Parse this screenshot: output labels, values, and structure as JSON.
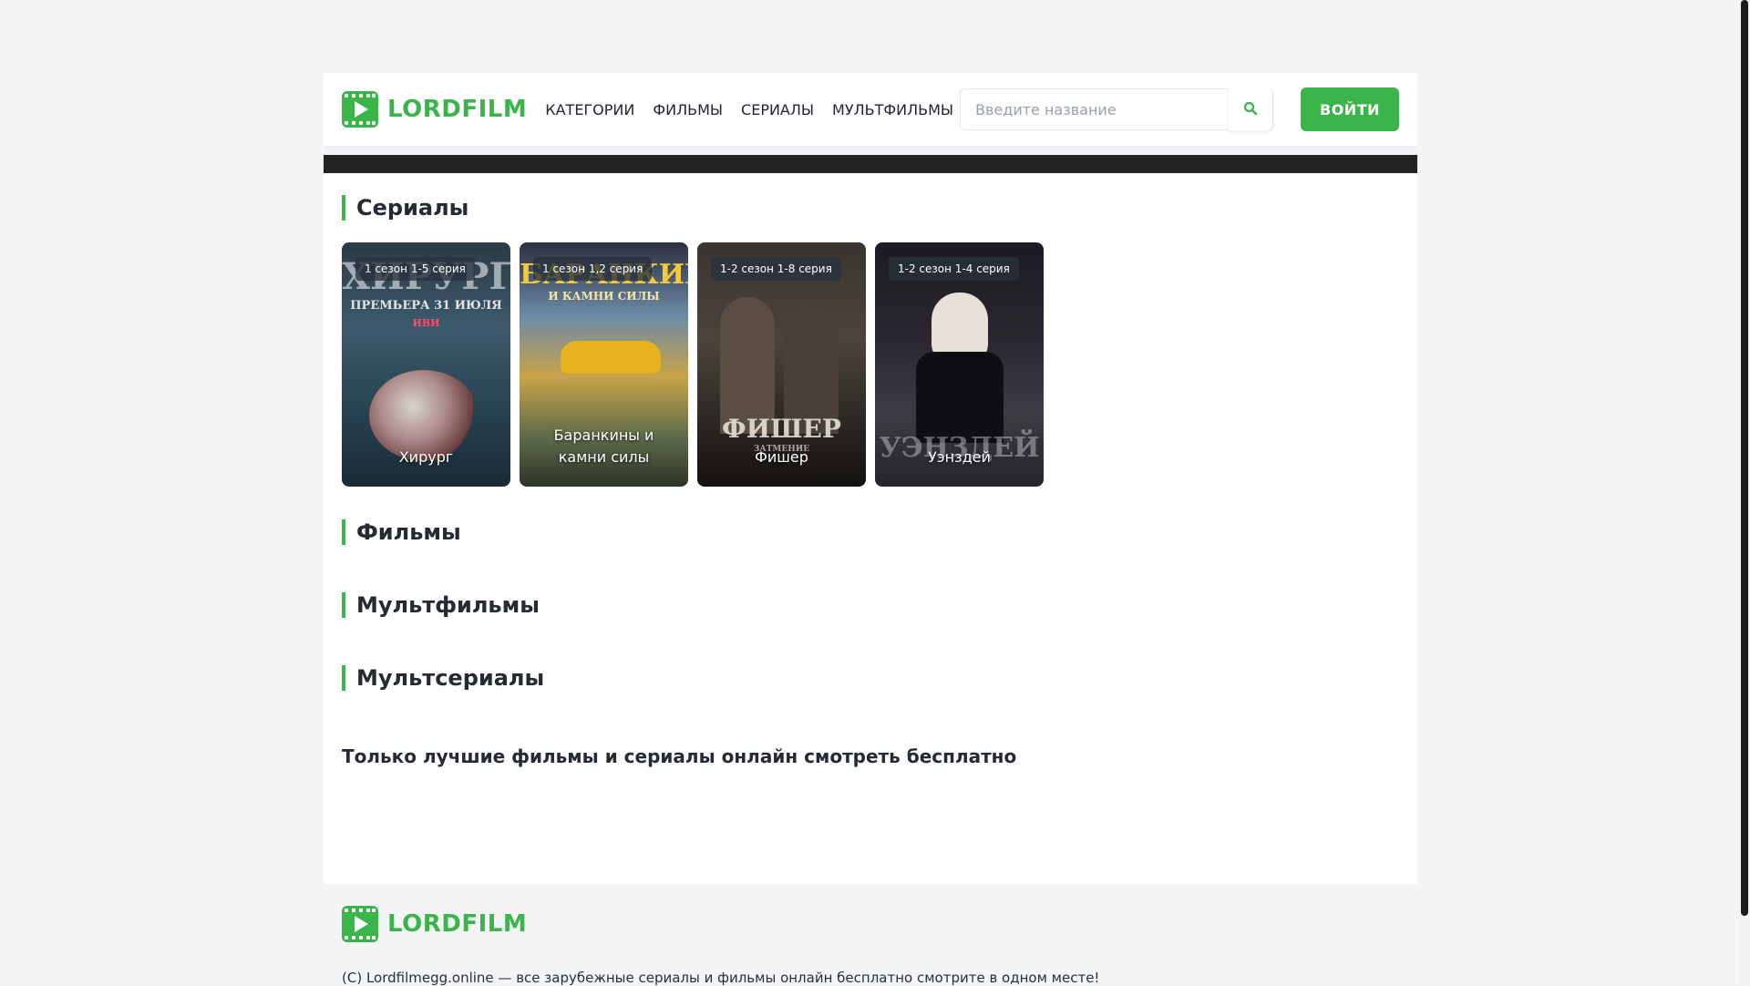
{
  "brand": {
    "name": "LORDFILM",
    "accent_color": "#3bb44a"
  },
  "nav": {
    "items": [
      {
        "label": "КАТЕГОРИИ"
      },
      {
        "label": "ФИЛЬМЫ"
      },
      {
        "label": "СЕРИАЛЫ"
      },
      {
        "label": "МУЛЬТФИЛЬМЫ"
      }
    ]
  },
  "search": {
    "placeholder": "Введите название",
    "value": "",
    "icon": "search-icon"
  },
  "login": {
    "label": "ВОЙТИ"
  },
  "sections": {
    "series": {
      "title": "Сериалы",
      "cards": [
        {
          "badge": "1 сезон 1-5 серия",
          "title": "Хирург",
          "poster_lines": [
            "ХИРУРГ",
            "ПРЕМЬЕРА 31 ИЮЛЯ",
            "ИВИ"
          ]
        },
        {
          "badge": "1 сезон 1,2 серия",
          "title": "Баранкины и камни силы",
          "poster_lines": [
            "БАРАНКИНЫ",
            "И КАМНИ СИЛЫ"
          ]
        },
        {
          "badge": "1-2 сезон 1-8 серия",
          "title": "Фишер",
          "poster_lines": [
            "ФИШЕР",
            "ЗАТМЕНИЕ"
          ]
        },
        {
          "badge": "1-2 сезон 1-4 серия",
          "title": "Уэнздей",
          "poster_lines": [
            "УЭНЗДЕЙ"
          ]
        }
      ]
    },
    "films": {
      "title": "Фильмы"
    },
    "cartoons": {
      "title": "Мультфильмы"
    },
    "cartoon_series": {
      "title": "Мультсериалы"
    }
  },
  "seo_text": "Только лучшие фильмы и сериалы онлайн смотреть бесплатно",
  "footer": {
    "brand": "LORDFILM",
    "text": "(C) Lordfilmegg.online — все зарубежные сериалы и фильмы онлайн бесплатно смотрите в одном месте!"
  }
}
